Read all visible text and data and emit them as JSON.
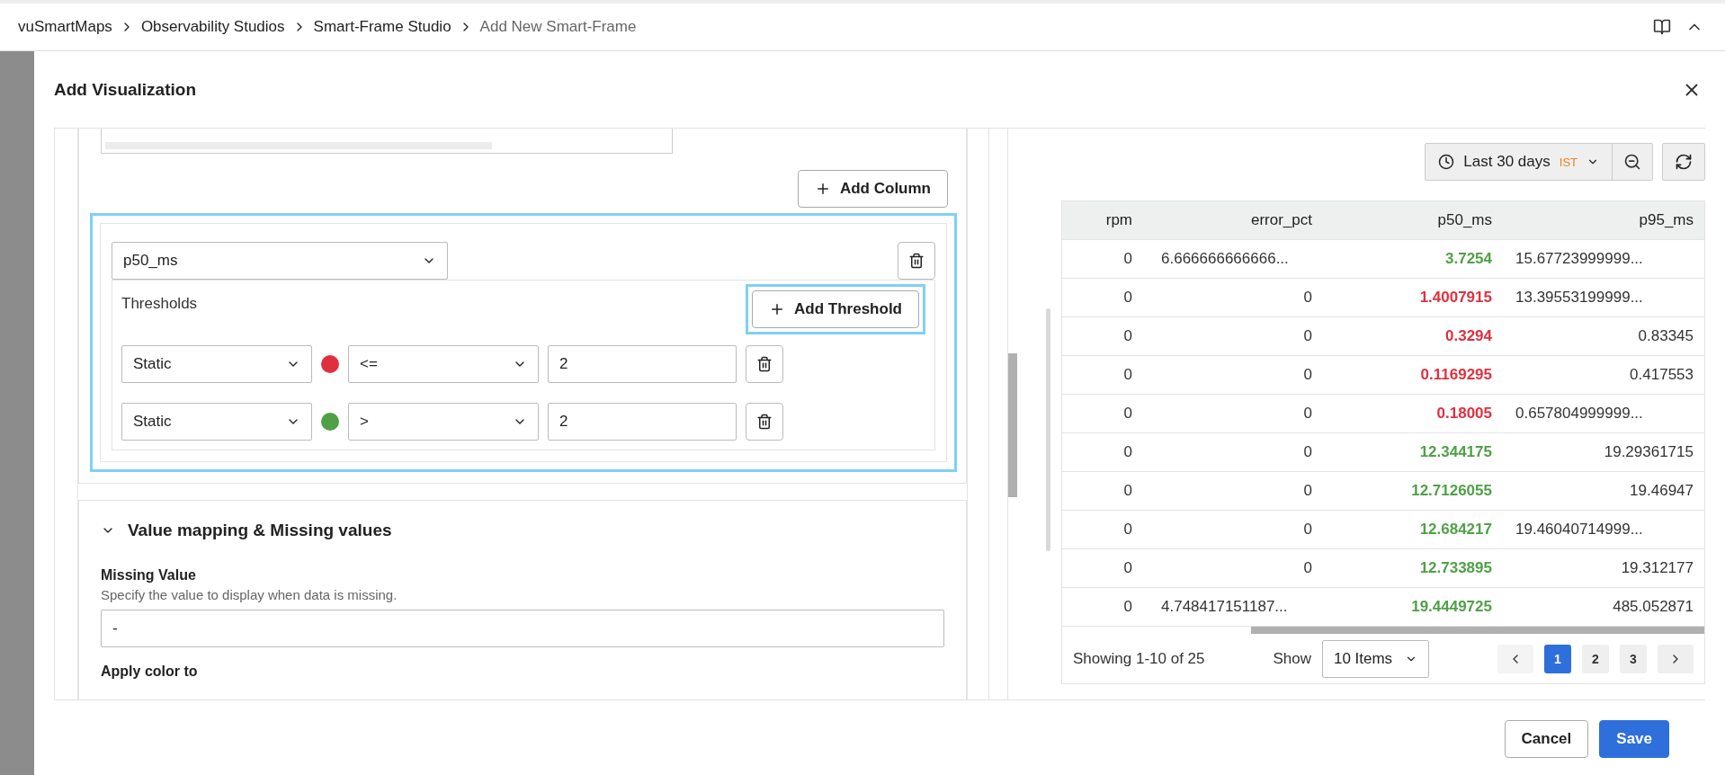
{
  "breadcrumb": {
    "items": [
      "vuSmartMaps",
      "Observability Studios",
      "Smart-Frame Studio"
    ],
    "current": "Add New Smart-Frame"
  },
  "dialog": {
    "title": "Add Visualization"
  },
  "column_config": {
    "add_column": "Add Column",
    "column": "p50_ms",
    "thresholds_label": "Thresholds",
    "add_threshold": "Add Threshold",
    "thresholds": [
      {
        "type": "Static",
        "color": "#e0303f",
        "operator": "<=",
        "value": "2"
      },
      {
        "type": "Static",
        "color": "#4fa046",
        "operator": ">",
        "value": "2"
      }
    ]
  },
  "value_mapping": {
    "title": "Value mapping & Missing values",
    "expanded": true,
    "missing_label": "Missing Value",
    "missing_help": "Specify the value to display when data is missing.",
    "missing_value": "-",
    "apply_color_label": "Apply color to"
  },
  "time_picker": {
    "label": "Last 30 days",
    "zone": "IST"
  },
  "table": {
    "columns": [
      "rpm",
      "error_pct",
      "p50_ms",
      "p95_ms"
    ],
    "rows": [
      {
        "rpm": "0",
        "error_pct": "6.666666666666...",
        "p50_ms": {
          "text": "3.7254",
          "color": "#4fa046"
        },
        "p95_ms": "15.67723999999..."
      },
      {
        "rpm": "0",
        "error_pct": "0",
        "p50_ms": {
          "text": "1.4007915",
          "color": "#e0303f"
        },
        "p95_ms": "13.39553199999..."
      },
      {
        "rpm": "0",
        "error_pct": "0",
        "p50_ms": {
          "text": "0.3294",
          "color": "#e0303f"
        },
        "p95_ms": "0.83345"
      },
      {
        "rpm": "0",
        "error_pct": "0",
        "p50_ms": {
          "text": "0.1169295",
          "color": "#e0303f"
        },
        "p95_ms": "0.417553"
      },
      {
        "rpm": "0",
        "error_pct": "0",
        "p50_ms": {
          "text": "0.18005",
          "color": "#e0303f"
        },
        "p95_ms": "0.657804999999..."
      },
      {
        "rpm": "0",
        "error_pct": "0",
        "p50_ms": {
          "text": "12.344175",
          "color": "#4fa046"
        },
        "p95_ms": "19.29361715"
      },
      {
        "rpm": "0",
        "error_pct": "0",
        "p50_ms": {
          "text": "12.7126055",
          "color": "#4fa046"
        },
        "p95_ms": "19.46947"
      },
      {
        "rpm": "0",
        "error_pct": "0",
        "p50_ms": {
          "text": "12.684217",
          "color": "#4fa046"
        },
        "p95_ms": "19.46040714999..."
      },
      {
        "rpm": "0",
        "error_pct": "0",
        "p50_ms": {
          "text": "12.733895",
          "color": "#4fa046"
        },
        "p95_ms": "19.312177"
      },
      {
        "rpm": "0",
        "error_pct": "4.748417151187...",
        "p50_ms": {
          "text": "19.4449725",
          "color": "#4fa046"
        },
        "p95_ms": "485.052871"
      }
    ]
  },
  "pagination": {
    "summary": "Showing 1-10 of 25",
    "show_label": "Show",
    "page_size": "10 Items",
    "pages": [
      {
        "label": "1",
        "selected": true
      },
      {
        "label": "2",
        "selected": false
      },
      {
        "label": "3",
        "selected": false
      }
    ]
  },
  "footer": {
    "cancel": "Cancel",
    "save": "Save"
  }
}
